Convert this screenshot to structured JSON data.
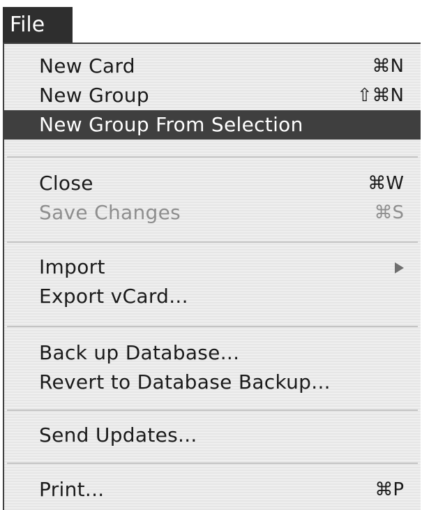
{
  "menu": {
    "title": "File",
    "items": [
      {
        "label": "New Card",
        "shortcut": "⌘N"
      },
      {
        "label": "New Group",
        "shortcut": "⇧⌘N"
      },
      {
        "label": "New Group From Selection",
        "shortcut": ""
      },
      {
        "label": "Close",
        "shortcut": "⌘W"
      },
      {
        "label": "Save Changes",
        "shortcut": "⌘S"
      },
      {
        "label": "Import",
        "icon": "submenu-arrow-icon"
      },
      {
        "label": "Export vCard..."
      },
      {
        "label": "Back up Database..."
      },
      {
        "label": "Revert to Database Backup..."
      },
      {
        "label": "Send Updates..."
      },
      {
        "label": "Print...",
        "shortcut": "⌘P"
      }
    ]
  },
  "colors": {
    "highlight": "#3f3f3f",
    "disabled_text": "#8e8e8e",
    "menu_background": "#ececec"
  }
}
